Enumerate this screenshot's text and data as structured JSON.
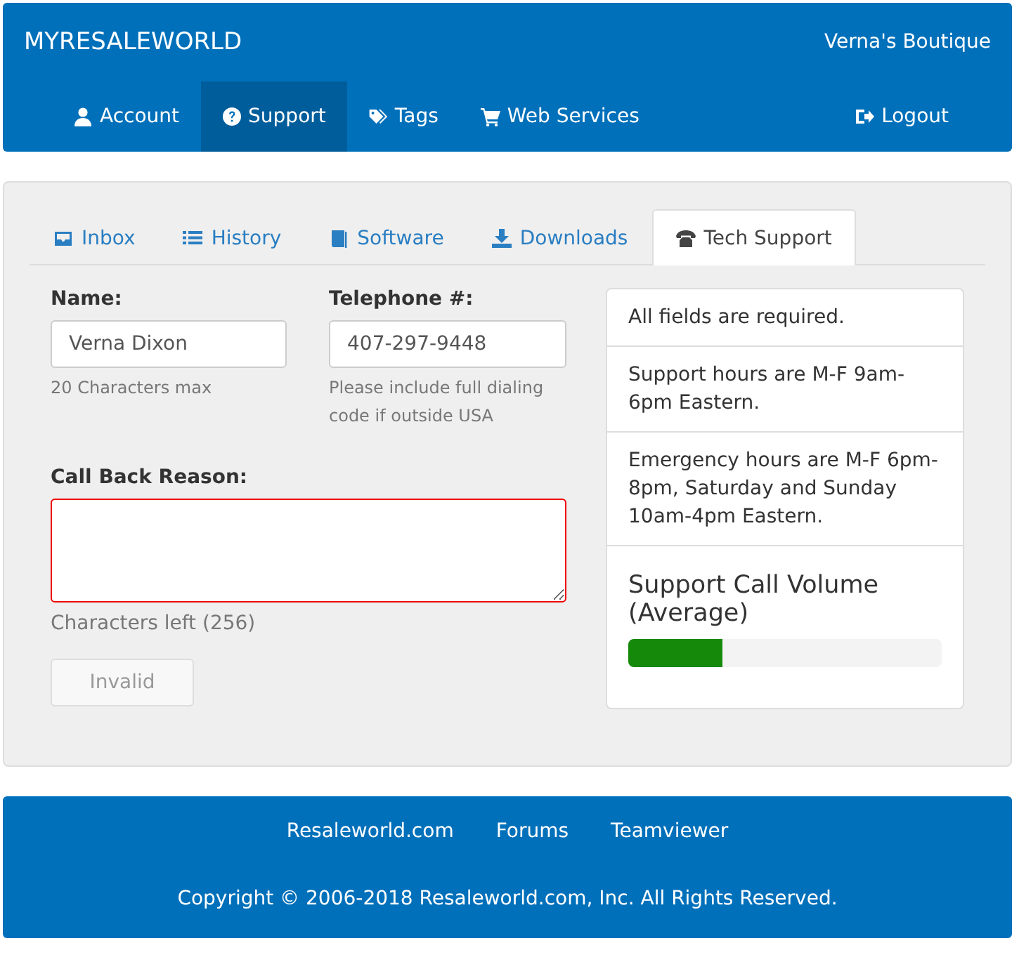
{
  "header": {
    "brand": "MYRESALEWORLD",
    "store": "Verna's Boutique",
    "nav": [
      {
        "label": "Account",
        "kind": "user",
        "selected": false
      },
      {
        "label": "Support",
        "kind": "help",
        "selected": true
      },
      {
        "label": "Tags",
        "kind": "tags",
        "selected": false
      },
      {
        "label": "Web Services",
        "kind": "cart",
        "selected": false
      }
    ],
    "logout": "Logout"
  },
  "tabs": [
    {
      "label": "Inbox",
      "kind": "inbox",
      "selected": false
    },
    {
      "label": "History",
      "kind": "list",
      "selected": false
    },
    {
      "label": "Software",
      "kind": "book",
      "selected": false
    },
    {
      "label": "Downloads",
      "kind": "download",
      "selected": false
    },
    {
      "label": "Tech Support",
      "kind": "phone",
      "selected": true
    }
  ],
  "form": {
    "name": {
      "label": "Name:",
      "value": "Verna Dixon",
      "help": "20 Characters max"
    },
    "telephone": {
      "label": "Telephone #:",
      "value": "407-297-9448",
      "help": "Please include full dialing code if outside USA"
    },
    "reason": {
      "label": "Call Back Reason:",
      "invalid": true,
      "counter": "Characters left (256)"
    },
    "submit": {
      "label": "Invalid",
      "disabled": true
    }
  },
  "info": {
    "notes": [
      "All fields are required.",
      "Support hours are M-F 9am-6pm Eastern.",
      "Emergency hours are M-F 6pm-8pm, Saturday and Sunday 10am-4pm Eastern."
    ],
    "volume": {
      "title": "Support Call Volume (Average)",
      "level": 0.3
    }
  },
  "footer": {
    "links": [
      "Resaleworld.com",
      "Forums",
      "Teamviewer"
    ],
    "copyright": "Copyright © 2006-2018 Resaleworld.com, Inc. All Rights Reserved."
  }
}
